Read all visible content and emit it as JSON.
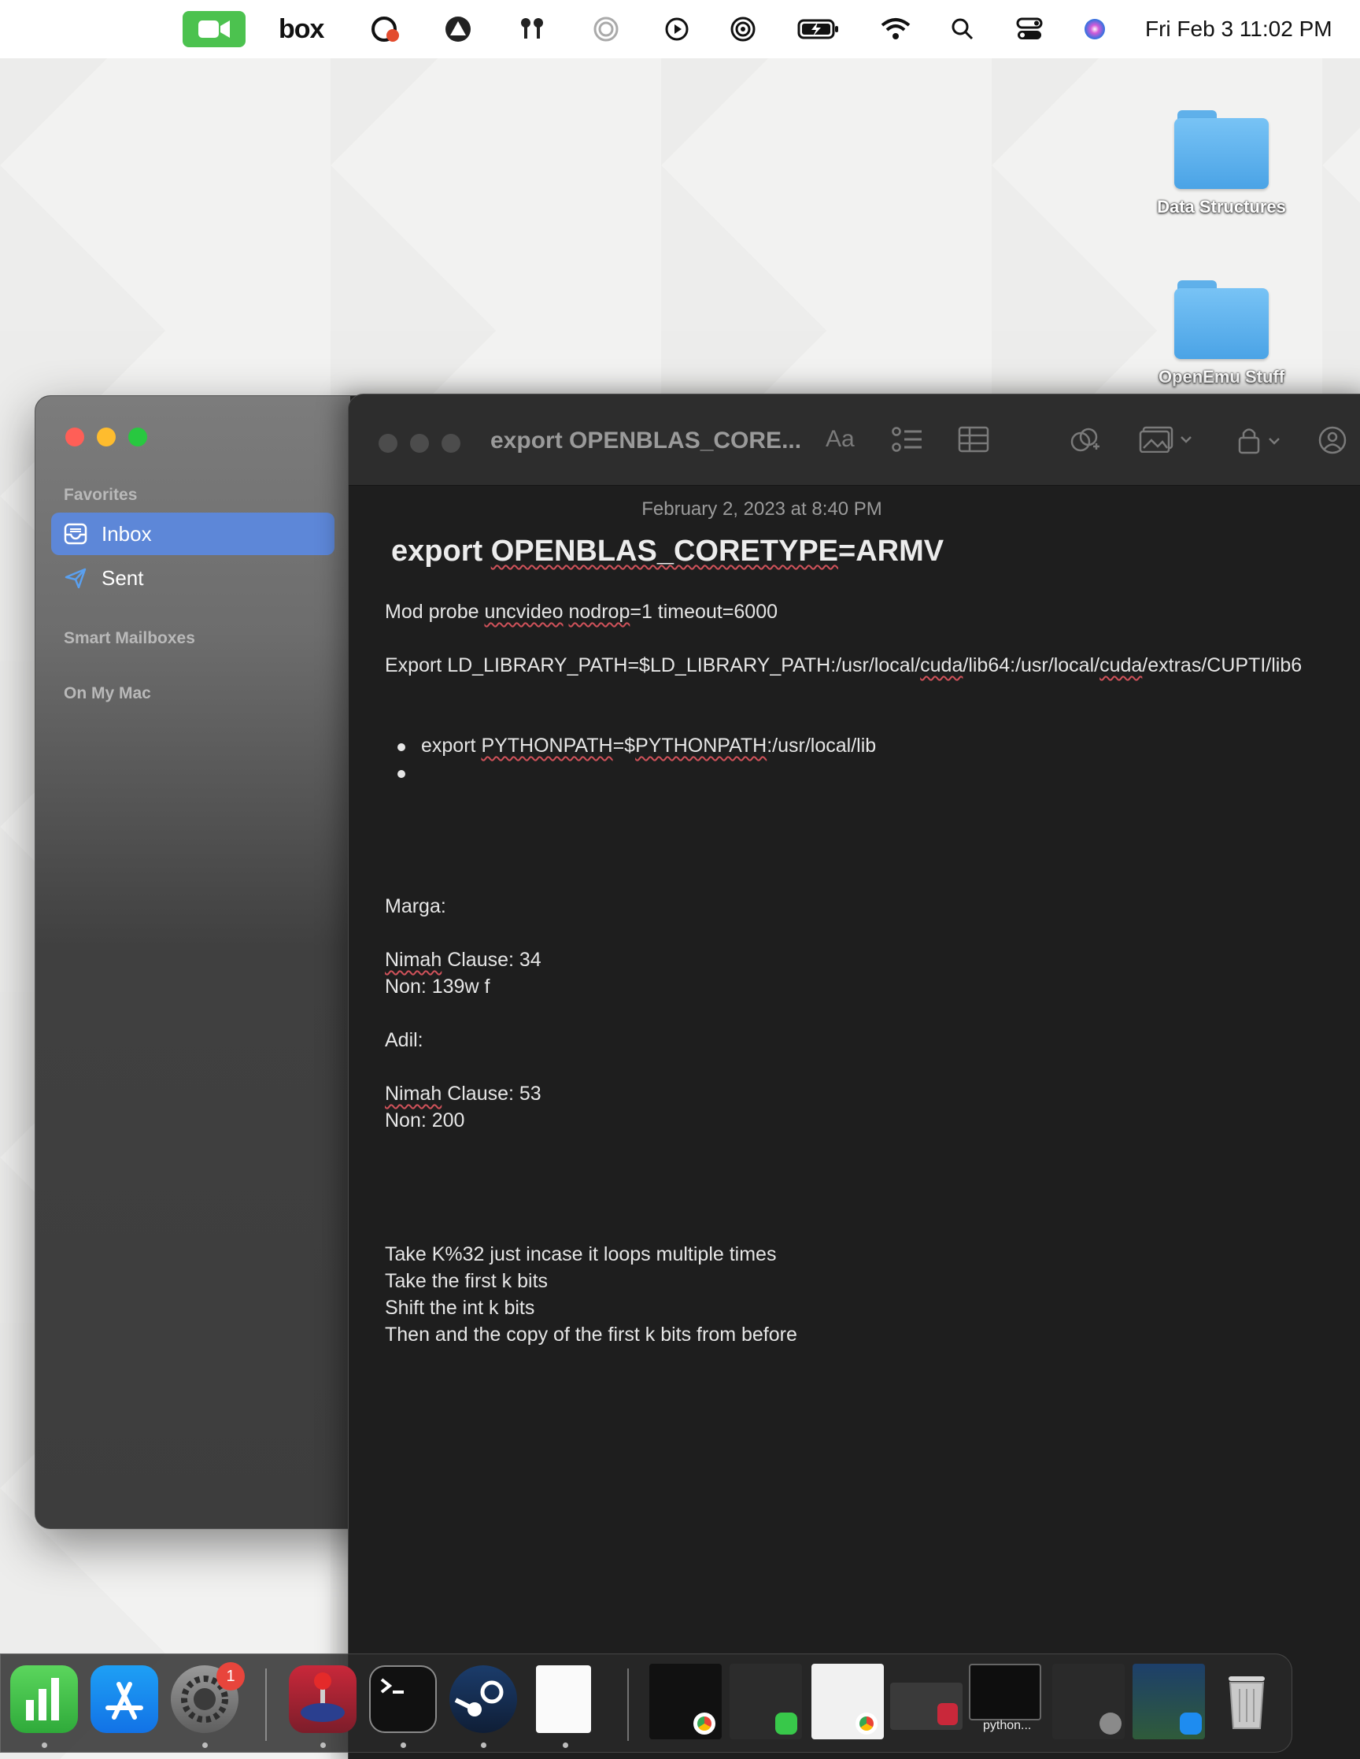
{
  "menubar": {
    "box_label": "box",
    "clock": "Fri Feb 3  11:02 PM"
  },
  "desktop": {
    "items": [
      {
        "label": "Data Structures"
      },
      {
        "label": "OpenEmu Stuff"
      }
    ]
  },
  "mail": {
    "sidebar": {
      "favorites_header": "Favorites",
      "items": [
        {
          "label": "Inbox",
          "selected": true
        },
        {
          "label": "Sent"
        }
      ],
      "smart_mailboxes_header": "Smart Mailboxes",
      "on_my_mac_header": "On My Mac"
    }
  },
  "note": {
    "toolbar_title": "export OPENBLAS_CORE...",
    "format_button": "Aa",
    "date": "February 2, 2023 at 8:40 PM",
    "heading": {
      "prefix": "export ",
      "word": "OPENBLAS_CORETYPE",
      "suffix": "=ARMV"
    },
    "lines": {
      "mod_probe": {
        "a": "Mod probe ",
        "b": "uncvideo",
        "c": " ",
        "d": "nodrop",
        "e": "=1 timeout=6000"
      },
      "export_ld": {
        "a": "Export LD_LIBRARY_PATH=$LD_LIBRARY_PATH:/usr/local/",
        "b": "cuda",
        "c": "/lib64:/usr/local/",
        "d": "cuda",
        "e": "/extras/CUPTI/lib6"
      },
      "bullet1": {
        "a": "export ",
        "b": "PYTHONPATH",
        "c": "=$",
        "d": "PYTHONPATH",
        "e": ":/usr/local/lib"
      },
      "marga": "Marga:",
      "marga_nimah": {
        "a": "Nimah",
        "b": " Clause: 34"
      },
      "marga_non": "Non: 139w f",
      "adil": "Adil:",
      "adil_nimah": {
        "a": "Nimah",
        "b": " Clause: 53"
      },
      "adil_non": "Non: 200",
      "take1": "Take K%32 just incase it loops multiple times",
      "take2": "Take the first k bits",
      "take3": "Shift the int k bits",
      "take4": "Then and the copy of the first k bits from before"
    }
  },
  "dock": {
    "settings_badge": "1",
    "python_thumb_label": "python..."
  },
  "colors": {
    "accent_selection": "#5d87d8",
    "facetime_green": "#4cc24f",
    "folder_blue": "#5fb0ea",
    "spell_underline": "#d0525a"
  },
  "icons": [
    "facetime-icon",
    "box-icon",
    "creative-cloud-icon",
    "vpn-icon",
    "airpods-icon",
    "focus-icon",
    "play-icon",
    "airdrop-icon",
    "battery-icon",
    "wifi-icon",
    "search-icon",
    "control-center-icon",
    "siri-icon"
  ]
}
